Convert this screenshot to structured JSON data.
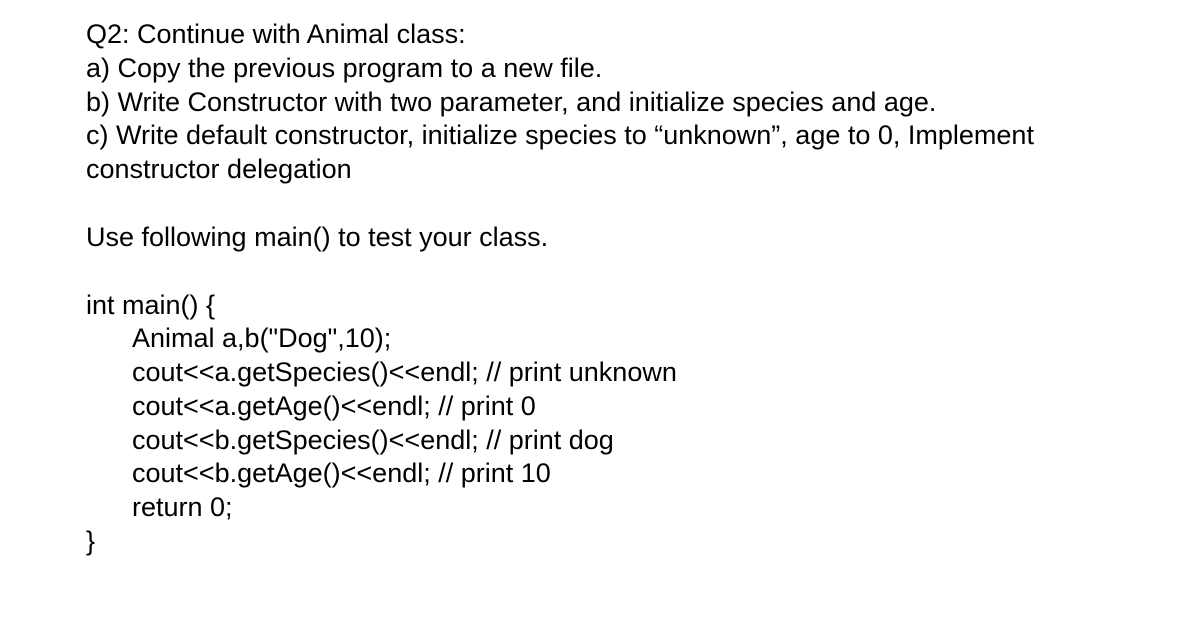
{
  "lines": {
    "l1": "Q2: Continue with Animal class:",
    "l2": "a) Copy the previous program to a new file.",
    "l3": "b) Write Constructor with two parameter, and initialize species and age.",
    "l4": "c) Write default constructor, initialize species to “unknown”, age to 0, Implement",
    "l5": "constructor delegation",
    "l6": "Use following main() to test your class.",
    "l7": "int main() {",
    "l8": "Animal a,b(\"Dog\",10);",
    "l9": "cout<<a.getSpecies()<<endl; // print unknown",
    "l10": "cout<<a.getAge()<<endl; // print 0",
    "l11": "cout<<b.getSpecies()<<endl; // print dog",
    "l12": "cout<<b.getAge()<<endl; // print 10",
    "l13": "return 0;",
    "l14": "}"
  }
}
